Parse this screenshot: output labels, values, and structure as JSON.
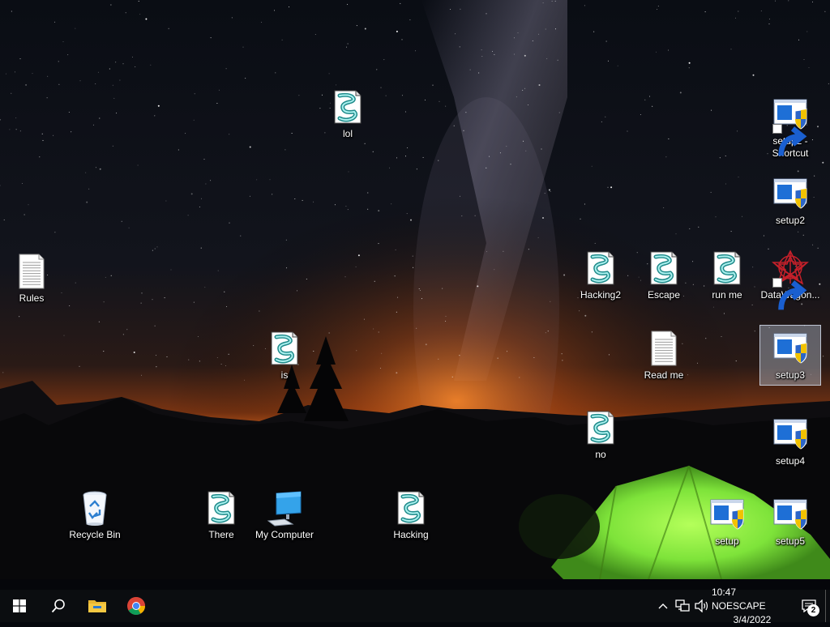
{
  "desktop": {
    "icons": [
      {
        "label": "lol",
        "iconType": "script"
      },
      {
        "label": "setup2 - Shortcut",
        "iconType": "installer",
        "shortcut": true
      },
      {
        "label": "setup2",
        "iconType": "installer"
      },
      {
        "label": "Rules",
        "iconType": "textfile"
      },
      {
        "label": "Hacking2",
        "iconType": "script"
      },
      {
        "label": "Escape",
        "iconType": "script"
      },
      {
        "label": "run me",
        "iconType": "script"
      },
      {
        "label": "DataWagon...",
        "iconType": "datawagon",
        "shortcut": true
      },
      {
        "label": "is",
        "iconType": "script"
      },
      {
        "label": "Read me",
        "iconType": "textfile"
      },
      {
        "label": "setup3",
        "iconType": "installer",
        "selected": true
      },
      {
        "label": "no",
        "iconType": "script"
      },
      {
        "label": "setup4",
        "iconType": "installer"
      },
      {
        "label": "Recycle Bin",
        "iconType": "recyclebin"
      },
      {
        "label": "There",
        "iconType": "script"
      },
      {
        "label": "My Computer",
        "iconType": "computer"
      },
      {
        "label": "Hacking",
        "iconType": "script"
      },
      {
        "label": "setup",
        "iconType": "installer"
      },
      {
        "label": "setup5",
        "iconType": "installer"
      }
    ]
  },
  "taskbar": {
    "start_icon": "windows-logo-icon",
    "search_icon": "search-icon",
    "pinned": [
      {
        "icon": "file-explorer-icon"
      },
      {
        "icon": "chrome-icon"
      }
    ],
    "tray": {
      "clock_time": "10:47 NOESCAPE",
      "clock_date": "3/4/2022",
      "notification_count": "2"
    }
  },
  "colors": {
    "taskbar_bg": "#0b0d10",
    "tent_green": "#7ee33a",
    "horizon_orange": "#e2701c"
  }
}
